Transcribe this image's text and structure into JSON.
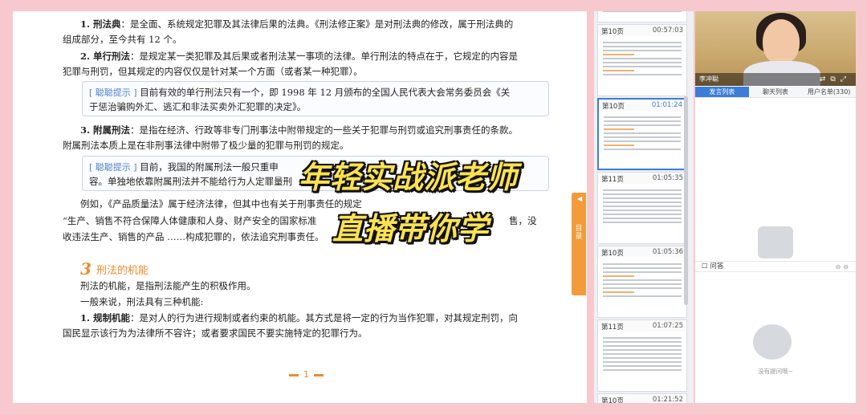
{
  "document": {
    "p1_label": "1. 刑法典",
    "p1_text": "：是全面、系统规定犯罪及其法律后果的法典。《刑法修正案》是对刑法典的修改，属于刑法典的",
    "p1_cont": "组成部分，至今共有 12 个。",
    "p2_label": "2. 单行刑法",
    "p2_text": "：是规定某一类犯罪及其后果或者刑法某一事项的法律。单行刑法的特点在于，它规定的内容是",
    "p2_cont": "犯罪与刑罚，但其规定的内容仅仅是针对某一个方面（或者某一种犯罪）。",
    "tip1_tag": "[ 聪聪提示 ]",
    "tip1_text": "目前有效的单行刑法只有一个，即 1998 年 12 月颁布的全国人民代表大会常务委员会《关",
    "tip1_cont": "于惩治骗购外汇、逃汇和非法买卖外汇犯罪的决定》。",
    "p3_label": "3. 附属刑法",
    "p3_text": "：是指在经济、行政等非专门刑事法中附带规定的一些关于犯罪与刑罚或追究刑事责任的条款。",
    "p3_cont": "附属刑法本质上是在非刑事法律中附带了极少量的犯罪与刑罚的规定。",
    "tip2_tag": "[ 聪聪提示 ]",
    "tip2_text": "目前，我国的附属刑法一般只重申",
    "tip2_cont": "容。单独地依靠附属刑法并不能给行为人定罪量刑",
    "example_line1": "例如，《产品质量法》属于经济法律，但其中也有关于刑事责任的规定",
    "example_line1_end": "售，没",
    "example_line2": "“生产、销售不符合保障人体健康和人身、财产安全的国家标准",
    "example_line3": "收违法生产、销售的产品 ……构成犯罪的，依法追究刑事责任。",
    "section_num": "3",
    "section_title": "刑法的机能",
    "s1": "刑法的机能，是指刑法能产生的积极作用。",
    "s2": "一般来说，刑法具有三种机能:",
    "s3_label": "1. 规制机能",
    "s3_text": "：是对人的行为进行规制或者约束的机能。其方式是将一定的行为当作犯罪，对其规定刑罚，向",
    "s3_cont": "国民显示该行为为法律所不容许；或者要求国民不要实施特定的犯罪行为。",
    "page_number": "1"
  },
  "overlay": {
    "line1": "年轻实战派老师",
    "line2": "直播带你学"
  },
  "sidetab": {
    "label": "目录"
  },
  "thumbnails": [
    {
      "page": "第10页",
      "time": "00:57:03",
      "active": false
    },
    {
      "page": "第10页",
      "time": "01:01:24",
      "active": true
    },
    {
      "page": "第11页",
      "time": "01:05:35",
      "active": false
    },
    {
      "page": "第10页",
      "time": "01:05:36",
      "active": false
    },
    {
      "page": "第11页",
      "time": "01:07:25",
      "active": false
    },
    {
      "page": "第10页",
      "time": "01:21:52",
      "active": false
    }
  ],
  "live": {
    "teacher_name": "李冲聪",
    "tabs": [
      "发言列表",
      "聊天列表",
      "用户名单(330)"
    ],
    "qa_title": "问答",
    "qa_empty": "没有提问哦~"
  }
}
